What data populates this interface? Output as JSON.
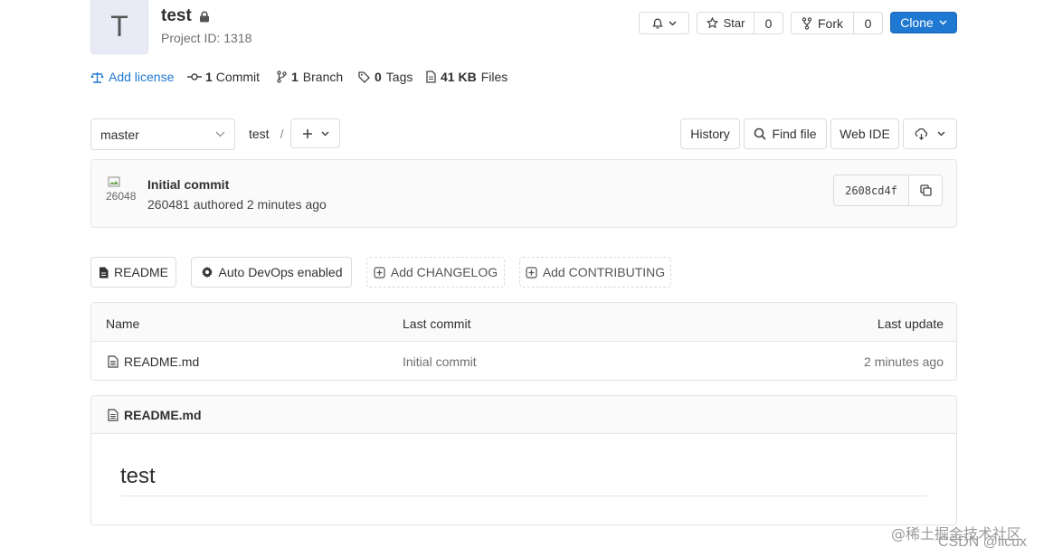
{
  "project": {
    "avatar_letter": "T",
    "name": "test",
    "id_label": "Project ID: 1318"
  },
  "actions": {
    "star_label": "Star",
    "star_count": "0",
    "fork_label": "Fork",
    "fork_count": "0",
    "clone_label": "Clone"
  },
  "stats": {
    "add_license": "Add license",
    "commit_count": "1",
    "commit_label": "Commit",
    "branch_count": "1",
    "branch_label": "Branch",
    "tags_count": "0",
    "tags_label": "Tags",
    "files_size": "41 KB",
    "files_label": "Files"
  },
  "repo_nav": {
    "branch": "master",
    "path": "test",
    "separator": "/",
    "history": "History",
    "find_file": "Find file",
    "web_ide": "Web IDE"
  },
  "last_commit": {
    "avatar_alt": "26048",
    "title": "Initial commit",
    "author": "260481",
    "meta": "authored 2 minutes ago",
    "sha": "2608cd4f"
  },
  "shortcuts": {
    "readme": "README",
    "auto_devops": "Auto DevOps enabled",
    "add_changelog": "Add CHANGELOG",
    "add_contributing": "Add CONTRIBUTING"
  },
  "file_table": {
    "headers": [
      "Name",
      "Last commit",
      "Last update"
    ],
    "rows": [
      {
        "name": "README.md",
        "commit": "Initial commit",
        "updated": "2 minutes ago"
      }
    ]
  },
  "readme": {
    "filename": "README.md",
    "heading": "test"
  },
  "watermark": {
    "line1": "@稀土掘金技术社区",
    "line2": "CSDN @licux"
  },
  "colors": {
    "accent": "#1f78d1",
    "link": "#1f78d1",
    "border": "#e5e5e5"
  }
}
